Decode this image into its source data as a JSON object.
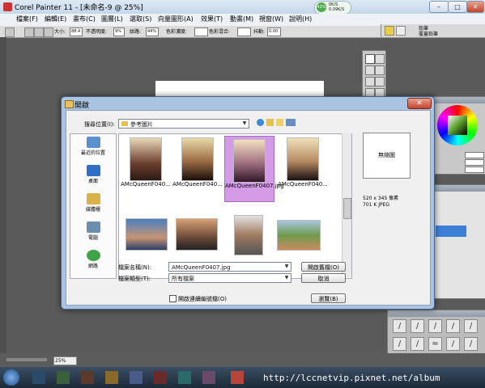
{
  "app": {
    "title": "Corel Painter 11 - [未命名-9 @ 25%]",
    "net_up": "0K/S",
    "net_down": "0.09K/S",
    "net_percent": "42%"
  },
  "window_controls": {
    "minimize": "–",
    "maximize": "□",
    "close": "✕"
  },
  "menu": [
    "檔案(F)",
    "編輯(E)",
    "畫布(C)",
    "圖層(L)",
    "選取(S)",
    "向量圖形(A)",
    "效果(T)",
    "動畫(M)",
    "視窗(W)",
    "說明(H)"
  ],
  "props": {
    "size_label": "大小:",
    "size_value": "88.4",
    "opacity_label": "不透明度:",
    "opacity_value": "9%",
    "grain_label": "紋路:",
    "grain_value": "44%",
    "resat_label": "色彩濃度:",
    "bleed_label": "色彩混合:",
    "jitter_label": "抖動:",
    "jitter_value": "0.00",
    "brush_category": "鉛筆",
    "brush_variant": "覆蓋鉛筆"
  },
  "dialog": {
    "title": "開啟",
    "close": "✕",
    "lookin_label": "搜尋位置(I):",
    "lookin_value": "參考圖片",
    "places": [
      {
        "label": "最近的位置",
        "icon": "recent-places-icon"
      },
      {
        "label": "桌面",
        "icon": "desktop-icon"
      },
      {
        "label": "媒體櫃",
        "icon": "libraries-icon"
      },
      {
        "label": "電腦",
        "icon": "computer-icon"
      },
      {
        "label": "網路",
        "icon": "network-icon"
      }
    ],
    "files_row1": [
      {
        "caption": "AMcQueenF040...",
        "selected": false
      },
      {
        "caption": "AMcQueenF040...",
        "selected": false
      },
      {
        "caption": "AMcQueenF0407.jpg",
        "selected": true
      },
      {
        "caption": "AMcQueenF040...",
        "selected": false
      }
    ],
    "files_row2": [
      {
        "caption": "",
        "selected": false
      },
      {
        "caption": "",
        "selected": false
      },
      {
        "caption": "",
        "selected": false
      },
      {
        "caption": "",
        "selected": false
      }
    ],
    "preview_text": "無縮圖",
    "image_dims": "520 x 345 像素",
    "image_info": "701 K  JPEG",
    "filename_label": "檔案名稱(N):",
    "filename_value": "AMcQueenF0407.jpg",
    "filetype_label": "檔案類型(T):",
    "filetype_value": "所有檔案",
    "open_button": "開啟舊檔(O)",
    "cancel_button": "取消",
    "sequence_checkbox_label": "開啟連續編號檔(O)",
    "browse_button": "瀏覽(B)"
  },
  "status": {
    "zoom": "25%"
  },
  "watermark": "http://lccnetvip.pixnet.net/album"
}
